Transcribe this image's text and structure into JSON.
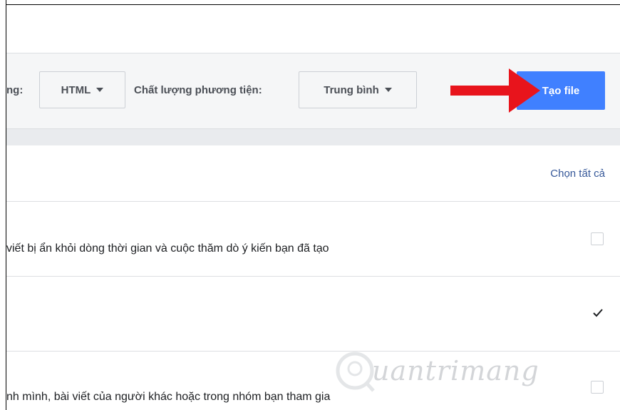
{
  "toolbar": {
    "format_label_partial": "ng:",
    "format_value": "HTML",
    "media_quality_label": "Chất lượng phương tiện:",
    "media_quality_value": "Trung bình",
    "create_button_label": "Tạo file"
  },
  "list": {
    "select_all_label": "Chọn tất cả",
    "rows": [
      {
        "text": " viết bị ẩn khỏi dòng thời gian và cuộc thăm dò ý kiến bạn đã tạo",
        "checked": false
      },
      {
        "text": "",
        "checked": true
      },
      {
        "text": "nh mình, bài viết của người khác hoặc trong nhóm bạn tham gia",
        "checked": false
      }
    ]
  },
  "watermark": {
    "text": "uantrimang"
  },
  "colors": {
    "primary": "#4080ff",
    "arrow": "#e8141c",
    "link": "#365899"
  },
  "icons": {
    "annotation": "red-arrow-icon",
    "check": "checkmark-icon"
  }
}
